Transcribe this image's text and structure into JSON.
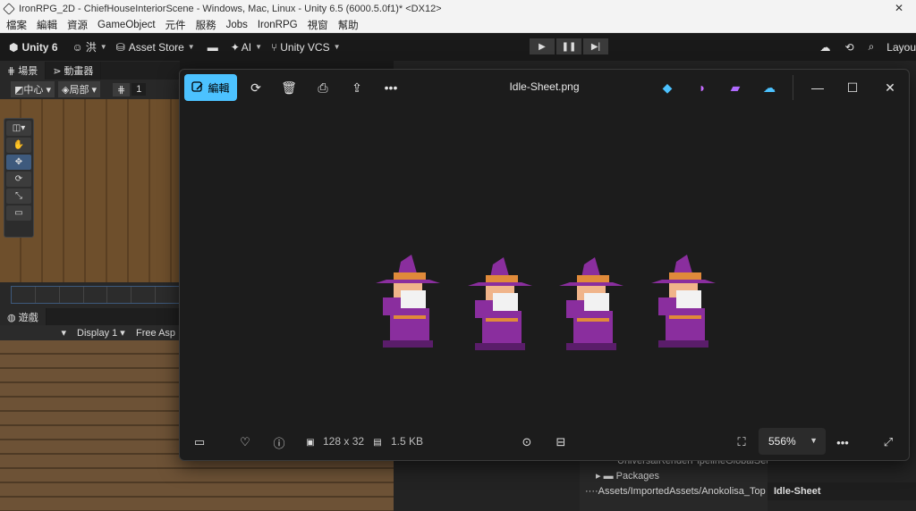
{
  "unity": {
    "window_title": "IronRPG_2D - ChiefHouseInteriorScene - Windows, Mac, Linux - Unity 6.5 (6000.5.0f1)* <DX12>",
    "menu": [
      "檔案",
      "編輯",
      "資源",
      "GameObject",
      "元件",
      "服務",
      "Jobs",
      "IronRPG",
      "視窗",
      "幫助"
    ],
    "toolbar": {
      "logo_label": "Unity 6",
      "account_label": "洪",
      "asset_store_label": "Asset Store",
      "ai_label": "AI",
      "vcs_label": "Unity VCS",
      "layout_label": "Layou"
    },
    "scene_tabs": [
      "場景",
      "動畫器"
    ],
    "scene_toolbar": {
      "pivot_center": "中心",
      "pivot_local": "局部",
      "grid_value": "1"
    },
    "game_tab": "遊戲",
    "game_toolbar": {
      "display": "Display 1",
      "aspect": "Free Asp"
    },
    "project_items": [
      "UniversalRenderPipelineGlobalSet",
      "Packages",
      "····Assets/ImportedAssets/Anokolisa_Top"
    ],
    "inspector_footer": "Idle-Sheet"
  },
  "viewer": {
    "edit_label": "編輯",
    "file_name": "Idle-Sheet.png",
    "dimensions": "128 x 32",
    "file_size": "1.5 KB",
    "zoom": "556%",
    "sprite_frames": 4,
    "colors": {
      "accent": "#4cc2ff",
      "robe": "#8a2e9e",
      "hat_band": "#e08a3a",
      "beard": "#f2f2f2",
      "skin": "#f0b48a"
    }
  }
}
